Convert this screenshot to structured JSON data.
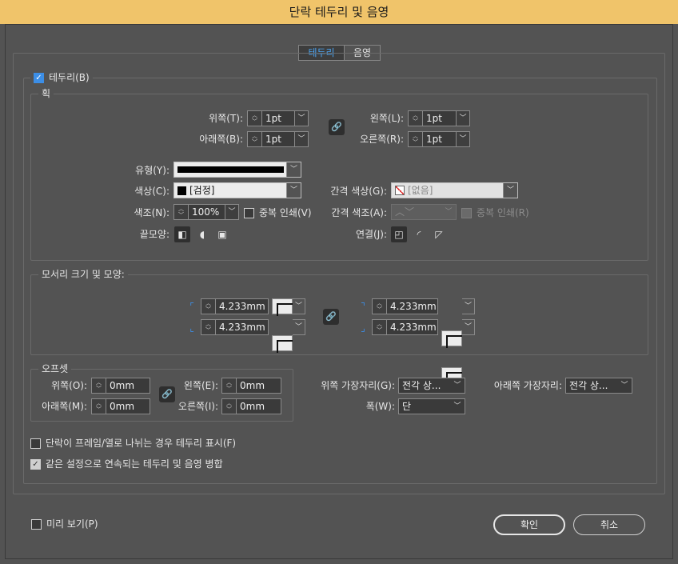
{
  "window": {
    "title": "단락 테두리 및 음영"
  },
  "tabs": [
    {
      "label": "테두리",
      "active": true
    },
    {
      "label": "음영",
      "active": false
    }
  ],
  "border_checkbox": {
    "label": "테두리(B)",
    "checked": true
  },
  "stroke": {
    "group_label": "획",
    "top": {
      "label": "위쪽(T):",
      "value": "1pt"
    },
    "bottom": {
      "label": "아래쪽(B):",
      "value": "1pt"
    },
    "left": {
      "label": "왼쪽(L):",
      "value": "1pt"
    },
    "right": {
      "label": "오른쪽(R):",
      "value": "1pt"
    },
    "type_label": "유형(Y):",
    "color_label": "색상(C):",
    "color_value": "[검정]",
    "tint_label": "색조(N):",
    "tint_value": "100%",
    "overprint_label": "중복 인쇄(V)",
    "gap_color_label": "간격 색상(G):",
    "gap_color_value": "[없음]",
    "gap_tint_label": "간격 색조(A):",
    "gap_overprint_label": "중복 인쇄(R)",
    "cap_label": "끝모양:",
    "join_label": "연결(J):"
  },
  "corners": {
    "group_label": "모서리 크기 및 모양:",
    "top_left": "4.233mm",
    "bottom_left": "4.233mm",
    "top_right": "4.233mm",
    "bottom_right": "4.233mm"
  },
  "offset": {
    "group_label": "오프셋",
    "top": {
      "label": "위쪽(O):",
      "value": "0mm"
    },
    "bottom": {
      "label": "아래쪽(M):",
      "value": "0mm"
    },
    "left": {
      "label": "왼쪽(E):",
      "value": "0mm"
    },
    "right": {
      "label": "오른쪽(I):",
      "value": "0mm"
    }
  },
  "top_edge": {
    "label": "위쪽 가장자리(G):",
    "value": "전각 상..."
  },
  "bottom_edge": {
    "label": "아래쪽 가장자리:",
    "value": "전각 상..."
  },
  "width": {
    "label": "폭(W):",
    "value": "단"
  },
  "split_border": {
    "label": "단락이 프레임/열로 나뉘는 경우 테두리 표시(F)",
    "checked": false
  },
  "merge_border": {
    "label": "같은 설정으로 연속되는 테두리 및 음영 병합",
    "checked": true
  },
  "preview": {
    "label": "미리 보기(P)",
    "checked": false
  },
  "buttons": {
    "ok": "확인",
    "cancel": "취소"
  },
  "colors": {
    "accent": "#3c8ee6",
    "titlebar": "#f0c46a",
    "background": "#535353"
  }
}
